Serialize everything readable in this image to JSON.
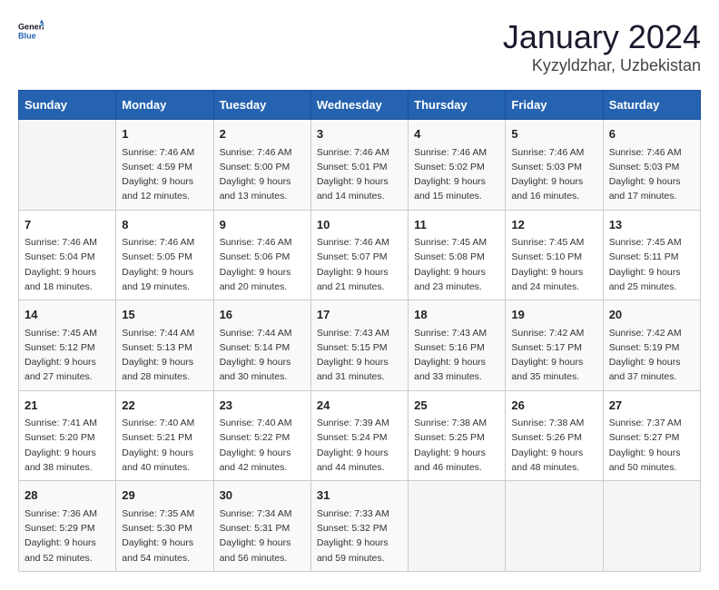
{
  "header": {
    "logo_general": "General",
    "logo_blue": "Blue",
    "title": "January 2024",
    "subtitle": "Kyzyldzhar, Uzbekistan"
  },
  "weekdays": [
    "Sunday",
    "Monday",
    "Tuesday",
    "Wednesday",
    "Thursday",
    "Friday",
    "Saturday"
  ],
  "weeks": [
    [
      {
        "day": "",
        "info": ""
      },
      {
        "day": "1",
        "info": "Sunrise: 7:46 AM\nSunset: 4:59 PM\nDaylight: 9 hours\nand 12 minutes."
      },
      {
        "day": "2",
        "info": "Sunrise: 7:46 AM\nSunset: 5:00 PM\nDaylight: 9 hours\nand 13 minutes."
      },
      {
        "day": "3",
        "info": "Sunrise: 7:46 AM\nSunset: 5:01 PM\nDaylight: 9 hours\nand 14 minutes."
      },
      {
        "day": "4",
        "info": "Sunrise: 7:46 AM\nSunset: 5:02 PM\nDaylight: 9 hours\nand 15 minutes."
      },
      {
        "day": "5",
        "info": "Sunrise: 7:46 AM\nSunset: 5:03 PM\nDaylight: 9 hours\nand 16 minutes."
      },
      {
        "day": "6",
        "info": "Sunrise: 7:46 AM\nSunset: 5:03 PM\nDaylight: 9 hours\nand 17 minutes."
      }
    ],
    [
      {
        "day": "7",
        "info": "Sunrise: 7:46 AM\nSunset: 5:04 PM\nDaylight: 9 hours\nand 18 minutes."
      },
      {
        "day": "8",
        "info": "Sunrise: 7:46 AM\nSunset: 5:05 PM\nDaylight: 9 hours\nand 19 minutes."
      },
      {
        "day": "9",
        "info": "Sunrise: 7:46 AM\nSunset: 5:06 PM\nDaylight: 9 hours\nand 20 minutes."
      },
      {
        "day": "10",
        "info": "Sunrise: 7:46 AM\nSunset: 5:07 PM\nDaylight: 9 hours\nand 21 minutes."
      },
      {
        "day": "11",
        "info": "Sunrise: 7:45 AM\nSunset: 5:08 PM\nDaylight: 9 hours\nand 23 minutes."
      },
      {
        "day": "12",
        "info": "Sunrise: 7:45 AM\nSunset: 5:10 PM\nDaylight: 9 hours\nand 24 minutes."
      },
      {
        "day": "13",
        "info": "Sunrise: 7:45 AM\nSunset: 5:11 PM\nDaylight: 9 hours\nand 25 minutes."
      }
    ],
    [
      {
        "day": "14",
        "info": "Sunrise: 7:45 AM\nSunset: 5:12 PM\nDaylight: 9 hours\nand 27 minutes."
      },
      {
        "day": "15",
        "info": "Sunrise: 7:44 AM\nSunset: 5:13 PM\nDaylight: 9 hours\nand 28 minutes."
      },
      {
        "day": "16",
        "info": "Sunrise: 7:44 AM\nSunset: 5:14 PM\nDaylight: 9 hours\nand 30 minutes."
      },
      {
        "day": "17",
        "info": "Sunrise: 7:43 AM\nSunset: 5:15 PM\nDaylight: 9 hours\nand 31 minutes."
      },
      {
        "day": "18",
        "info": "Sunrise: 7:43 AM\nSunset: 5:16 PM\nDaylight: 9 hours\nand 33 minutes."
      },
      {
        "day": "19",
        "info": "Sunrise: 7:42 AM\nSunset: 5:17 PM\nDaylight: 9 hours\nand 35 minutes."
      },
      {
        "day": "20",
        "info": "Sunrise: 7:42 AM\nSunset: 5:19 PM\nDaylight: 9 hours\nand 37 minutes."
      }
    ],
    [
      {
        "day": "21",
        "info": "Sunrise: 7:41 AM\nSunset: 5:20 PM\nDaylight: 9 hours\nand 38 minutes."
      },
      {
        "day": "22",
        "info": "Sunrise: 7:40 AM\nSunset: 5:21 PM\nDaylight: 9 hours\nand 40 minutes."
      },
      {
        "day": "23",
        "info": "Sunrise: 7:40 AM\nSunset: 5:22 PM\nDaylight: 9 hours\nand 42 minutes."
      },
      {
        "day": "24",
        "info": "Sunrise: 7:39 AM\nSunset: 5:24 PM\nDaylight: 9 hours\nand 44 minutes."
      },
      {
        "day": "25",
        "info": "Sunrise: 7:38 AM\nSunset: 5:25 PM\nDaylight: 9 hours\nand 46 minutes."
      },
      {
        "day": "26",
        "info": "Sunrise: 7:38 AM\nSunset: 5:26 PM\nDaylight: 9 hours\nand 48 minutes."
      },
      {
        "day": "27",
        "info": "Sunrise: 7:37 AM\nSunset: 5:27 PM\nDaylight: 9 hours\nand 50 minutes."
      }
    ],
    [
      {
        "day": "28",
        "info": "Sunrise: 7:36 AM\nSunset: 5:29 PM\nDaylight: 9 hours\nand 52 minutes."
      },
      {
        "day": "29",
        "info": "Sunrise: 7:35 AM\nSunset: 5:30 PM\nDaylight: 9 hours\nand 54 minutes."
      },
      {
        "day": "30",
        "info": "Sunrise: 7:34 AM\nSunset: 5:31 PM\nDaylight: 9 hours\nand 56 minutes."
      },
      {
        "day": "31",
        "info": "Sunrise: 7:33 AM\nSunset: 5:32 PM\nDaylight: 9 hours\nand 59 minutes."
      },
      {
        "day": "",
        "info": ""
      },
      {
        "day": "",
        "info": ""
      },
      {
        "day": "",
        "info": ""
      }
    ]
  ]
}
